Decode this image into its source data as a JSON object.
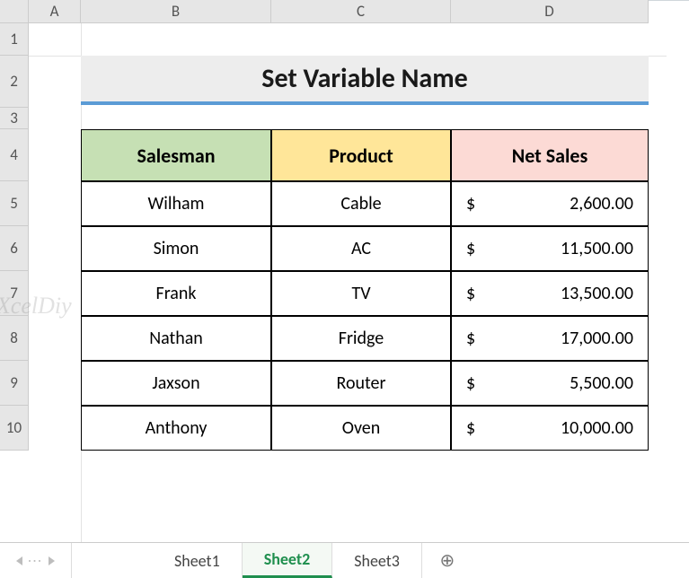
{
  "columns": [
    "A",
    "B",
    "C",
    "D"
  ],
  "rows": [
    "1",
    "2",
    "3",
    "4",
    "5",
    "6",
    "7",
    "8",
    "9",
    "10"
  ],
  "title": "Set Variable Name",
  "headers": {
    "salesman": "Salesman",
    "product": "Product",
    "netsales": "Net Sales"
  },
  "currency": "$",
  "data": [
    {
      "salesman": "Wilham",
      "product": "Cable",
      "netsales": "2,600.00"
    },
    {
      "salesman": "Simon",
      "product": "AC",
      "netsales": "11,500.00"
    },
    {
      "salesman": "Frank",
      "product": "TV",
      "netsales": "13,500.00"
    },
    {
      "salesman": "Nathan",
      "product": "Fridge",
      "netsales": "17,000.00"
    },
    {
      "salesman": "Jaxson",
      "product": "Router",
      "netsales": "5,500.00"
    },
    {
      "salesman": "Anthony",
      "product": "Oven",
      "netsales": "10,000.00"
    }
  ],
  "tabs": {
    "sheet1": "Sheet1",
    "sheet2": "Sheet2",
    "sheet3": "Sheet3"
  },
  "watermark": "eXcelDiy",
  "icons": {
    "plus": "⊕"
  }
}
